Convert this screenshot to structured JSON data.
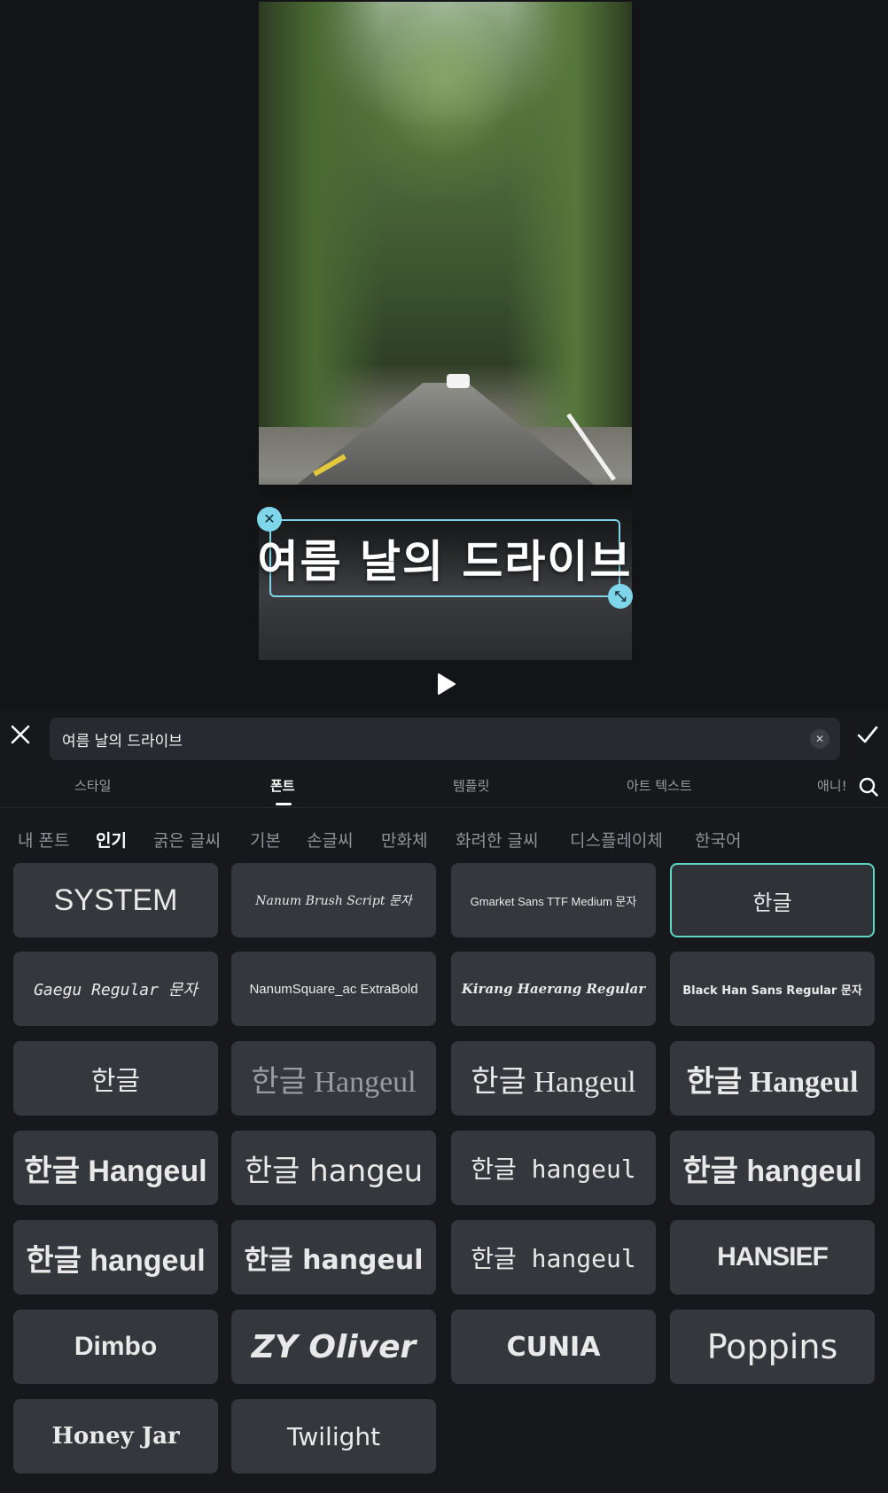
{
  "preview": {
    "overlay_text": "여름 날의 드라이브",
    "close_symbol": "✕",
    "resize_symbol": "⤡"
  },
  "editor": {
    "text_value": "여름 날의 드라이브",
    "clear_symbol": "✕"
  },
  "tabs": [
    {
      "label": "스타일",
      "active": false
    },
    {
      "label": "폰트",
      "active": true
    },
    {
      "label": "템플릿",
      "active": false
    },
    {
      "label": "아트 텍스트",
      "active": false
    },
    {
      "label": "애니!",
      "active": false
    }
  ],
  "categories": [
    {
      "label": "내 폰트",
      "active": false
    },
    {
      "label": "인기",
      "active": true
    },
    {
      "label": "굵은 글씨",
      "active": false
    },
    {
      "label": "기본",
      "active": false
    },
    {
      "label": "손글씨",
      "active": false
    },
    {
      "label": "만화체",
      "active": false
    },
    {
      "label": "화려한 글씨",
      "active": false
    },
    {
      "label": "디스플레이체",
      "active": false
    },
    {
      "label": "한국어",
      "active": false
    }
  ],
  "fonts": [
    {
      "label": "SYSTEM"
    },
    {
      "label": "Nanum Brush Script 문자"
    },
    {
      "label": "Gmarket Sans TTF Medium 문자"
    },
    {
      "label": "한글",
      "selected": true
    },
    {
      "label": "Gaegu Regular 문자"
    },
    {
      "label": "NanumSquare_ac ExtraBold"
    },
    {
      "label": "Kirang Haerang Regular"
    },
    {
      "label": "Black Han Sans Regular 문자"
    },
    {
      "label": "한글"
    },
    {
      "label": "한글 Hangeul"
    },
    {
      "label": "한글 Hangeul"
    },
    {
      "label": "한글 Hangeul"
    },
    {
      "label": "한글 Hangeul"
    },
    {
      "label": "한글 hangeu"
    },
    {
      "label": "한글 hangeul"
    },
    {
      "label": "한글 hangeul"
    },
    {
      "label": "한글 hangeul"
    },
    {
      "label": "한글 hangeul"
    },
    {
      "label": "한글 hangeul"
    },
    {
      "label": "HANSIEF"
    },
    {
      "label": "Dimbo"
    },
    {
      "label": "ZY Oliver"
    },
    {
      "label": "CUNIA"
    },
    {
      "label": "Poppins"
    },
    {
      "label": "Honey Jar"
    },
    {
      "label": "Twilight"
    }
  ]
}
